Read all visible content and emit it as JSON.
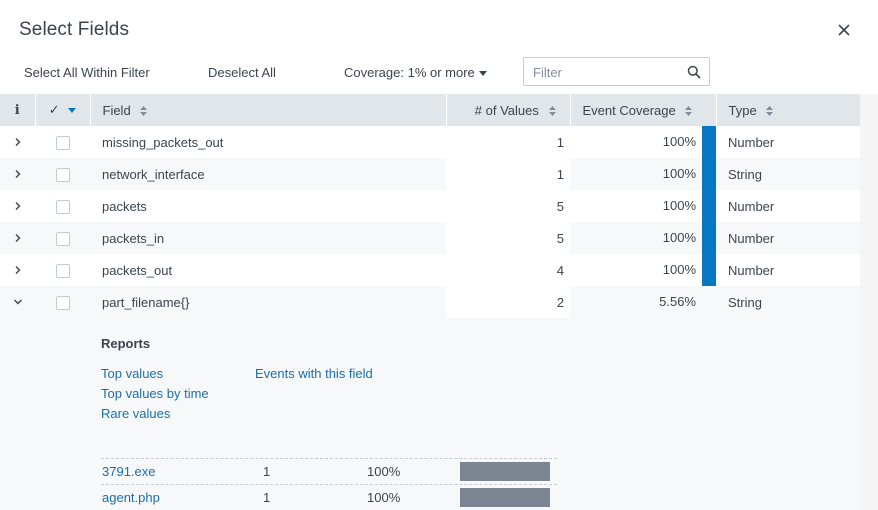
{
  "dialog": {
    "title": "Select Fields"
  },
  "toolbar": {
    "select_all": "Select All Within Filter",
    "deselect_all": "Deselect All",
    "coverage": "Coverage: 1% or more",
    "filter_placeholder": "Filter"
  },
  "columns": {
    "info": "i",
    "check": "✓",
    "field": "Field",
    "values": "# of Values",
    "coverage": "Event Coverage",
    "type": "Type"
  },
  "rows": [
    {
      "field": "missing_packets_out",
      "values": "1",
      "coverage": "100%",
      "coverage_fraction": 1.0,
      "type": "Number",
      "expanded": false
    },
    {
      "field": "network_interface",
      "values": "1",
      "coverage": "100%",
      "coverage_fraction": 1.0,
      "type": "String",
      "expanded": false
    },
    {
      "field": "packets",
      "values": "5",
      "coverage": "100%",
      "coverage_fraction": 1.0,
      "type": "Number",
      "expanded": false
    },
    {
      "field": "packets_in",
      "values": "5",
      "coverage": "100%",
      "coverage_fraction": 1.0,
      "type": "Number",
      "expanded": false
    },
    {
      "field": "packets_out",
      "values": "4",
      "coverage": "100%",
      "coverage_fraction": 1.0,
      "type": "Number",
      "expanded": false
    },
    {
      "field": "part_filename{}",
      "values": "2",
      "coverage": "5.56%",
      "coverage_fraction": 0.0556,
      "type": "String",
      "expanded": true
    }
  ],
  "details": {
    "reports_title": "Reports",
    "links": {
      "top_values": "Top values",
      "top_values_by_time": "Top values by time",
      "rare_values": "Rare values",
      "events_with_field": "Events with this field"
    },
    "top_values": [
      {
        "name": "3791.exe",
        "count": "1",
        "percent": "100%",
        "fraction": 1.0
      },
      {
        "name": "agent.php",
        "count": "1",
        "percent": "100%",
        "fraction": 1.0
      }
    ]
  },
  "colors": {
    "coverage_bar": "#0877c3",
    "header_bg": "#e1e6eb",
    "link": "#1a6fa8",
    "top_value_bar": "#7c8692"
  }
}
